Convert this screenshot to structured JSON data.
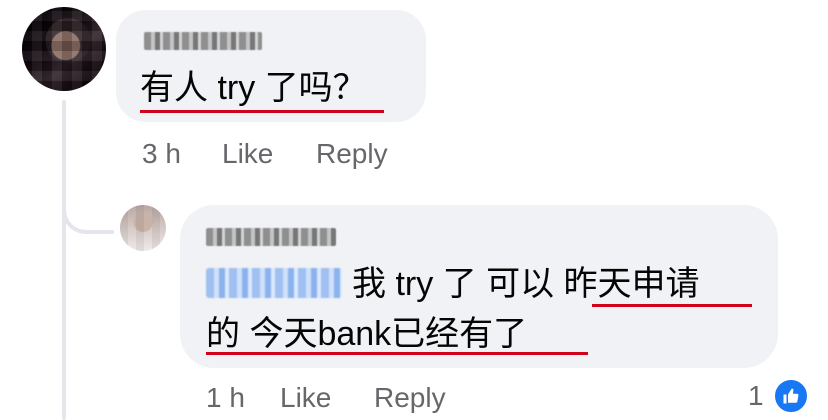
{
  "comment": {
    "text": "有人 try 了吗？",
    "time": "3 h",
    "like_label": "Like",
    "reply_label": "Reply"
  },
  "reply": {
    "line1": "我 try 了 可以 昨天申请",
    "line2": "的 今天bank已经有了",
    "time": "1 h",
    "like_label": "Like",
    "reply_label": "Reply",
    "reaction_count": "1"
  },
  "icons": {
    "reaction": "thumbs-up-icon"
  },
  "colors": {
    "bubble": "#f0f2f5",
    "meta_text": "#65676b",
    "underline": "#d0021b",
    "like_blue": "#1877f2"
  }
}
